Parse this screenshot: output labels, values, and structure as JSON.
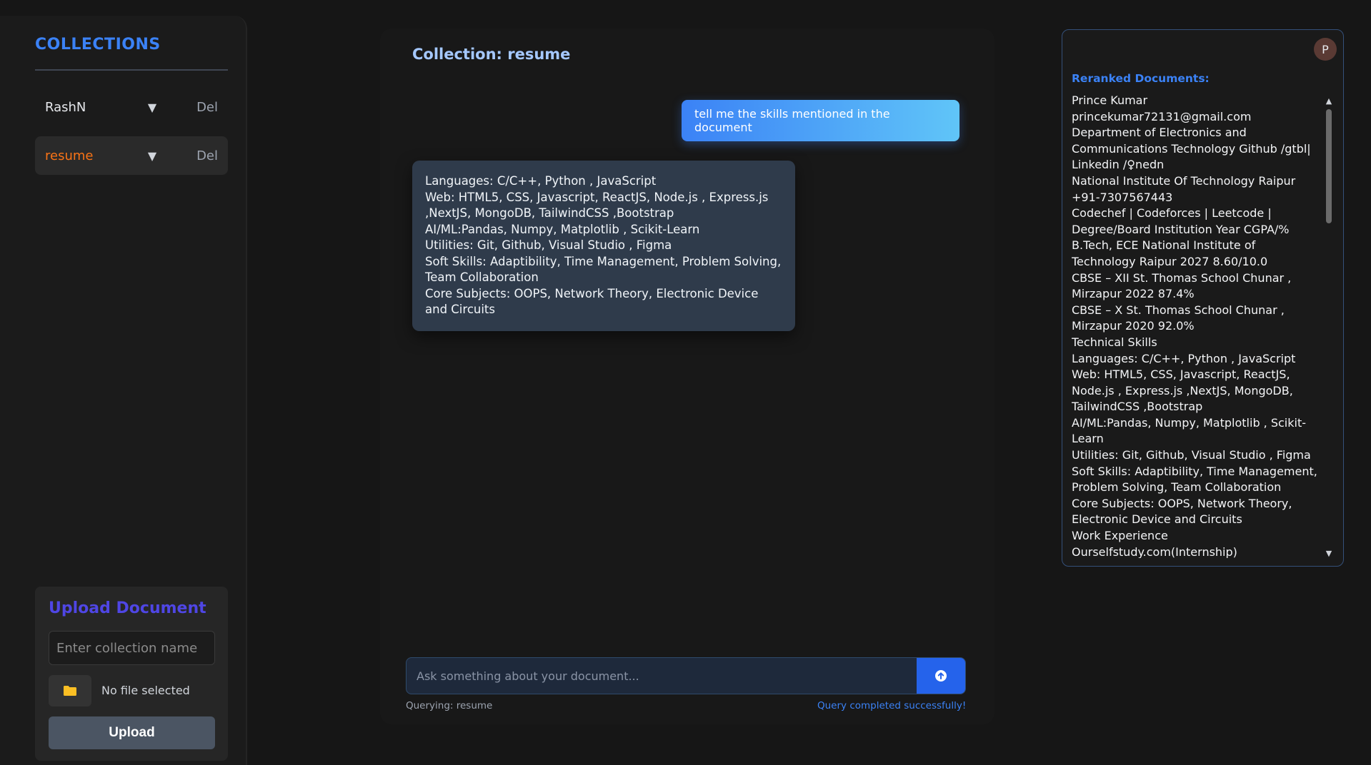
{
  "sidebar": {
    "title": "COLLECTIONS",
    "items": [
      {
        "name": "RashN",
        "caret": "▼",
        "delete_label": "Del"
      },
      {
        "name": "resume",
        "caret": "▼",
        "delete_label": "Del"
      }
    ],
    "upload": {
      "title": "Upload Document",
      "collection_placeholder": "Enter collection name",
      "file_status": "No file selected",
      "upload_label": "Upload"
    }
  },
  "chat": {
    "title": "Collection: resume",
    "user_message": "tell me the skills mentioned in the document",
    "bot_lines": [
      "Languages: C/C++, Python , JavaScript",
      "Web: HTML5, CSS, Javascript, ReactJS, Node.js , Express.js ,NextJS, MongoDB, TailwindCSS ,Bootstrap",
      "AI/ML:Pandas, Numpy, Matplotlib , Scikit-Learn",
      "Utilities: Git, Github, Visual Studio , Figma",
      "Soft Skills: Adaptibility, Time Management, Problem Solving, Team Collaboration",
      "Core Subjects: OOPS, Network Theory, Electronic Device and Circuits"
    ],
    "input_placeholder": "Ask something about your document...",
    "status_left": "Querying: resume",
    "status_right": "Query completed successfully!"
  },
  "rerank": {
    "avatar_letter": "P",
    "title": "Reranked Documents:",
    "lines": [
      "Prince Kumar",
      "princekumar72131@gmail.com",
      "Department of Electronics and Communications Technology Github /gtbl| Linkedin /♀nedn",
      "National Institute Of Technology Raipur +91-7307567443",
      "Codechef | Codeforces | Leetcode |",
      "Degree/Board Institution Year CGPA/%",
      "B.Tech, ECE National Institute of Technology Raipur 2027 8.60/10.0",
      "CBSE – XII St. Thomas School Chunar , Mirzapur 2022 87.4%",
      "CBSE – X St. Thomas School Chunar , Mirzapur 2020 92.0%",
      "Technical Skills",
      "Languages: C/C++, Python , JavaScript",
      "Web: HTML5, CSS, Javascript, ReactJS, Node.js , Express.js ,NextJS, MongoDB, TailwindCSS ,Bootstrap",
      "AI/ML:Pandas, Numpy, Matplotlib , Scikit-Learn",
      "Utilities: Git, Github, Visual Studio , Figma",
      "Soft Skills: Adaptibility, Time Management, Problem Solving, Team Collaboration",
      "Core Subjects: OOPS, Network Theory, Electronic Device and Circuits",
      "Work Experience",
      "Ourselfstudy.com(Internship)"
    ]
  },
  "colors": {
    "accent_blue": "#3b82f6",
    "active_orange": "#f97316",
    "upload_title": "#4f46e5"
  }
}
